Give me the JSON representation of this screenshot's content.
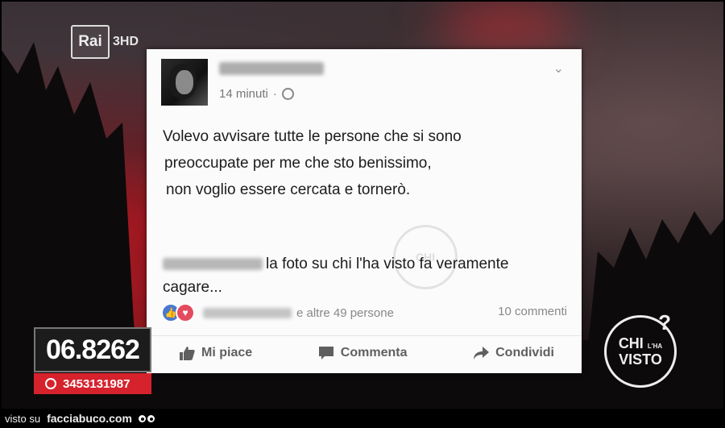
{
  "broadcast": {
    "channel_logo": "Rai",
    "channel_number": "3HD"
  },
  "post": {
    "time": "14 minuti",
    "lines": [
      "Volevo avvisare tutte le persone che si sono",
      "preoccupate per me che sto benissimo,",
      "non voglio essere cercata e tornerò."
    ]
  },
  "comment": {
    "text": "la foto su chi l'ha visto fa veramente cagare..."
  },
  "reactions": {
    "others": "e altre 49 persone",
    "comments_count": "10 commenti"
  },
  "actions": {
    "like": "Mi piace",
    "comment": "Commenta",
    "share": "Condividi"
  },
  "watermark": "CHI",
  "overlay": {
    "phone": "06.8262",
    "whatsapp": "3453131987"
  },
  "show_logo": {
    "line1": "CHI",
    "small": "L'HA",
    "line2": "VISTO",
    "mark": "?"
  },
  "footer": {
    "prefix": "visto su",
    "site": "facciabuco.com"
  },
  "colors": {
    "red": "#d6222c",
    "fb_blue": "#4a78d0",
    "love": "#e44b5f"
  }
}
